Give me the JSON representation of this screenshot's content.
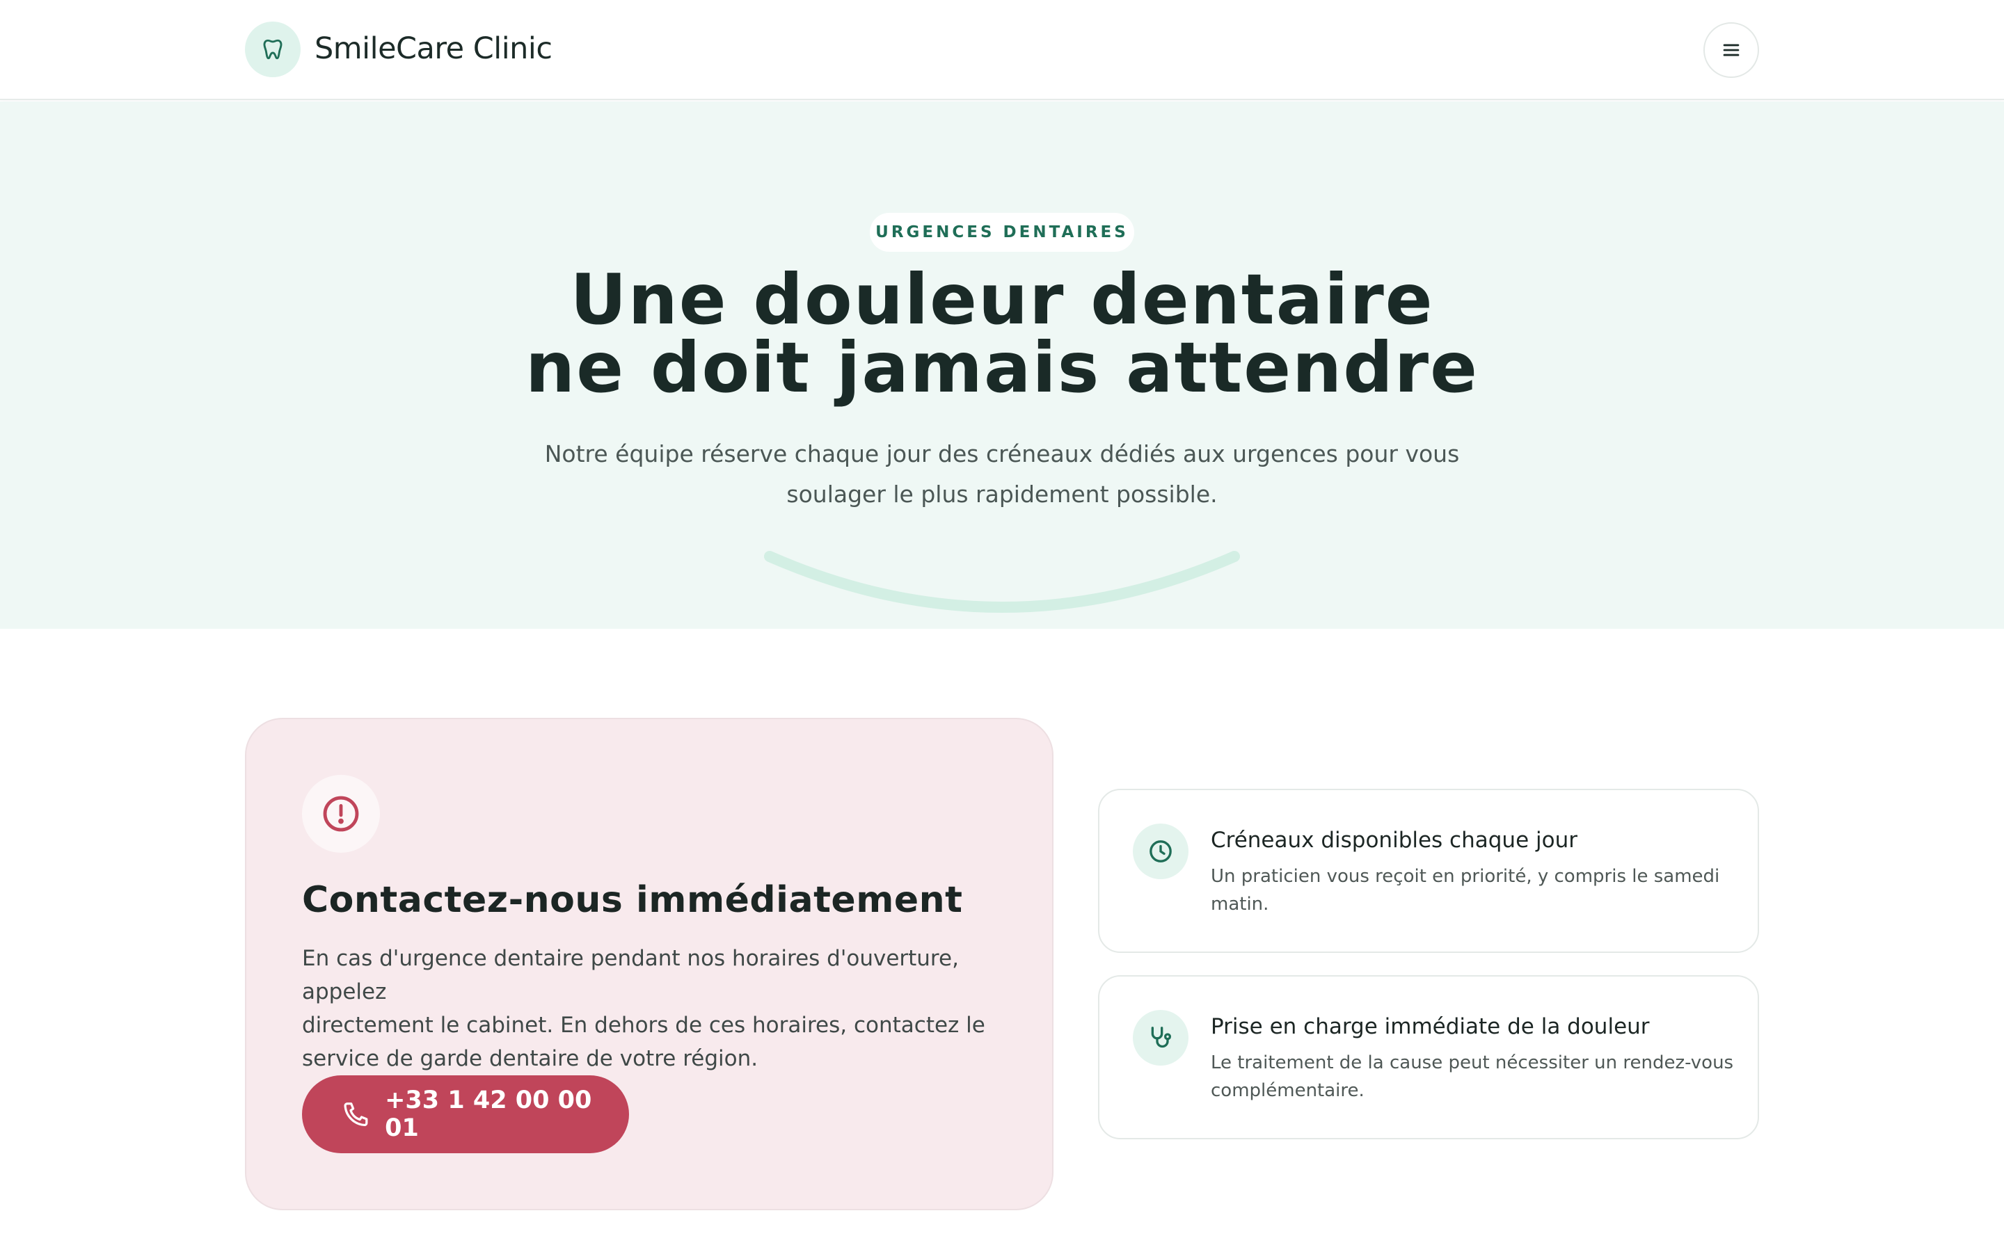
{
  "header": {
    "brand": "SmileCare Clinic",
    "logo_icon": "tooth-icon",
    "menu_icon": "menu-icon"
  },
  "hero": {
    "tag": "URGENCES DENTAIRES",
    "title_line1": "Une douleur dentaire",
    "title_line2": "ne doit jamais attendre",
    "subtitle_line1": "Notre équipe réserve chaque jour des créneaux dédiés aux urgences pour vous",
    "subtitle_line2": "soulager le plus rapidement possible."
  },
  "emergency": {
    "icon": "alert-circle-icon",
    "title": "Contactez-nous immédiatement",
    "text_line1": "En cas d'urgence dentaire pendant nos horaires d'ouverture, appelez",
    "text_line2": "directement le cabinet. En dehors de ces horaires, contactez le",
    "text_line3": "service de garde dentaire de votre région.",
    "phone_icon": "phone-icon",
    "phone": "+33 1 42 00 00 01"
  },
  "info": [
    {
      "icon": "clock-icon",
      "title": "Créneaux disponibles chaque jour",
      "text_line1": "Un praticien vous reçoit en priorité, y compris le samedi",
      "text_line2": "matin."
    },
    {
      "icon": "stethoscope-icon",
      "title": "Prise en charge immédiate de la douleur",
      "text_line1": "Le traitement de la cause peut nécessiter un rendez-vous",
      "text_line2": "complémentaire."
    }
  ],
  "colors": {
    "accent": "#1f6e57",
    "hero_bg": "#eff8f5",
    "emergency_bg": "#f8eaed",
    "emergency_button": "#c0455a"
  }
}
